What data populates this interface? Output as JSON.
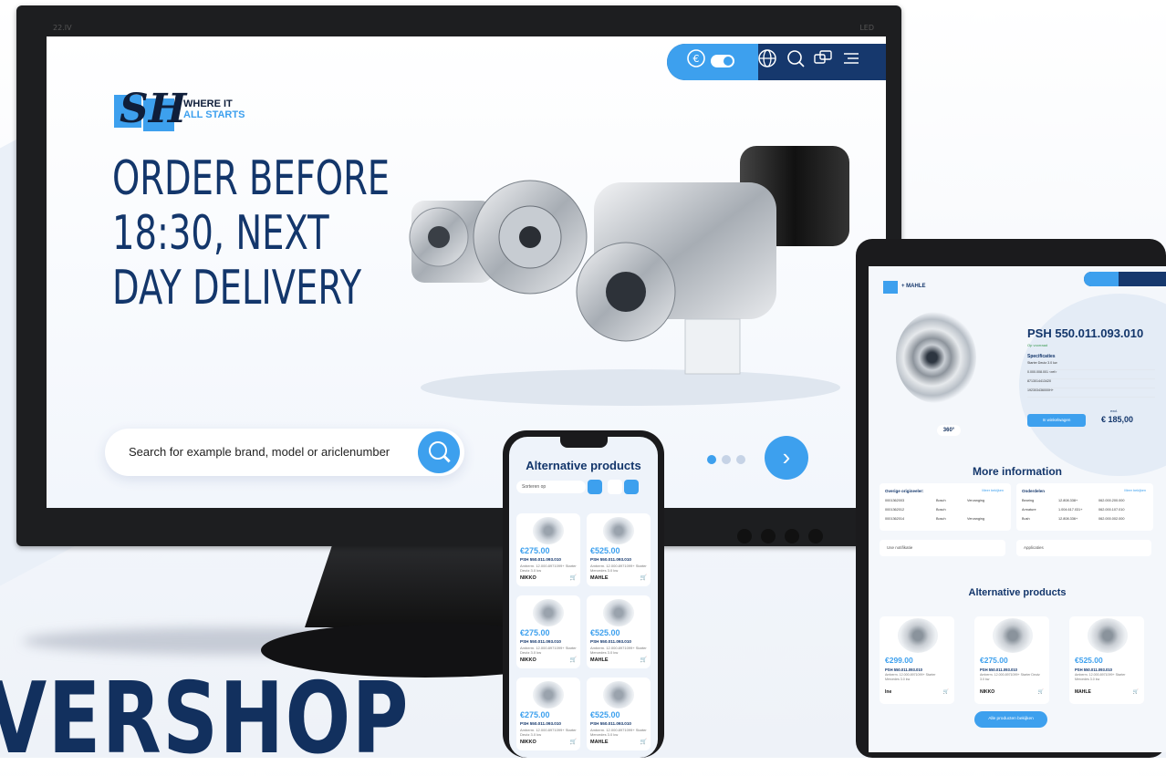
{
  "colors": {
    "accent": "#3da0ee",
    "navy": "#16386d",
    "text": "#13366b"
  },
  "background_word": "VERSHOP",
  "monitor": {
    "tag_left": "22.IV",
    "tag_right": "LED",
    "logo_line1": "WHERE IT",
    "logo_line2": "ALL STARTS",
    "headline_lines": [
      "ORDER BEFORE",
      "18:30, NEXT",
      "DAY DELIVERY"
    ],
    "search_placeholder": "Search for example brand, model or ariclenumber",
    "toolbar_icons": [
      "euro-icon",
      "toggle-icon",
      "globe-icon",
      "search-icon",
      "chat-icon",
      "menu-icon"
    ],
    "carousel_slides": 3,
    "carousel_active": 1
  },
  "phone": {
    "title": "Alternative products",
    "sort_label": "Sorteren op",
    "cards": [
      {
        "price": "€275.00",
        "code": "PSH 550.011.093.010",
        "desc": "Amberm. 12.000.8971099+ Starter Deutz 3.0 kw",
        "brand": "NIKKO"
      },
      {
        "price": "€525.00",
        "code": "PSH 550.011.093.010",
        "desc": "Amberm. 12.000.8971099+ Starter Mercedes 3.0 kw",
        "brand": "MAHLE"
      },
      {
        "price": "€275.00",
        "code": "PSH 550.011.093.010",
        "desc": "Amberm. 12.000.8971099+ Starter Deutz 3.0 kw",
        "brand": "NIKKO"
      },
      {
        "price": "€525.00",
        "code": "PSH 550.011.093.010",
        "desc": "Amberm. 12.000.8971099+ Starter Mercedes 3.0 kw",
        "brand": "MAHLE"
      },
      {
        "price": "€275.00",
        "code": "PSH 550.011.093.010",
        "desc": "Amberm. 12.000.8971099+ Starter Deutz 3.0 kw",
        "brand": "NIKKO"
      },
      {
        "price": "€525.00",
        "code": "PSH 550.011.093.010",
        "desc": "Amberm. 12.000.8971099+ Starter Mercedes 3.0 kw",
        "brand": "MAHLE"
      }
    ]
  },
  "tablet": {
    "brand_partner": "+ MAHLE",
    "product_title": "PSH 550.011.093.010",
    "stock": "Op voorraad",
    "spec_heading": "Specificaties",
    "spec_rows": [
      "Starter Deutz 3.0 kw",
      "0.000.008.001 <ref>",
      "8713014413420",
      "192303436000H+"
    ],
    "badge_360": "360°",
    "add_button": "In winkelwagen",
    "price_label": "excl.",
    "price": "€ 185,00",
    "more_info": "More information",
    "other_orig_heading": "Overige origineeler:",
    "parts_heading": "Onderdelen",
    "view_all": "Meer bekijken",
    "orig_rows": [
      [
        "0001362003",
        "Bosch",
        "Vervanging"
      ],
      [
        "0001362012",
        "Bosch",
        ""
      ],
      [
        "0001362014",
        "Bosch",
        "Vervanging"
      ]
    ],
    "parts_rows": [
      [
        "Bearing",
        "12.808.338+",
        "062.000.200.000"
      ],
      [
        "Armature",
        "1.004.617.031+",
        "062.000.107.010"
      ],
      [
        "Bush",
        "12.808.336+",
        "062.000.002.000"
      ]
    ],
    "dropdown1": "Use notifikatie",
    "dropdown2": "Applicaties",
    "alt_title": "Alternative products",
    "alt_cards": [
      {
        "price": "€299.00",
        "code": "PSH 550.011.093.010",
        "desc": "Amberm. 12.000.8971099+ Starter Mercedes 3.0 kw",
        "brand": "lne"
      },
      {
        "price": "€275.00",
        "code": "PSH 550.011.093.010",
        "desc": "Amberm. 12.000.8971099+ Starter Deutz 3.0 kw",
        "brand": "NIKKO"
      },
      {
        "price": "€525.00",
        "code": "PSH 550.011.093.010",
        "desc": "Amberm. 12.000.8971099+ Starter Mercedes 3.0 kw",
        "brand": "MAHLE"
      }
    ],
    "all_products": "Alle producten bekijken"
  }
}
